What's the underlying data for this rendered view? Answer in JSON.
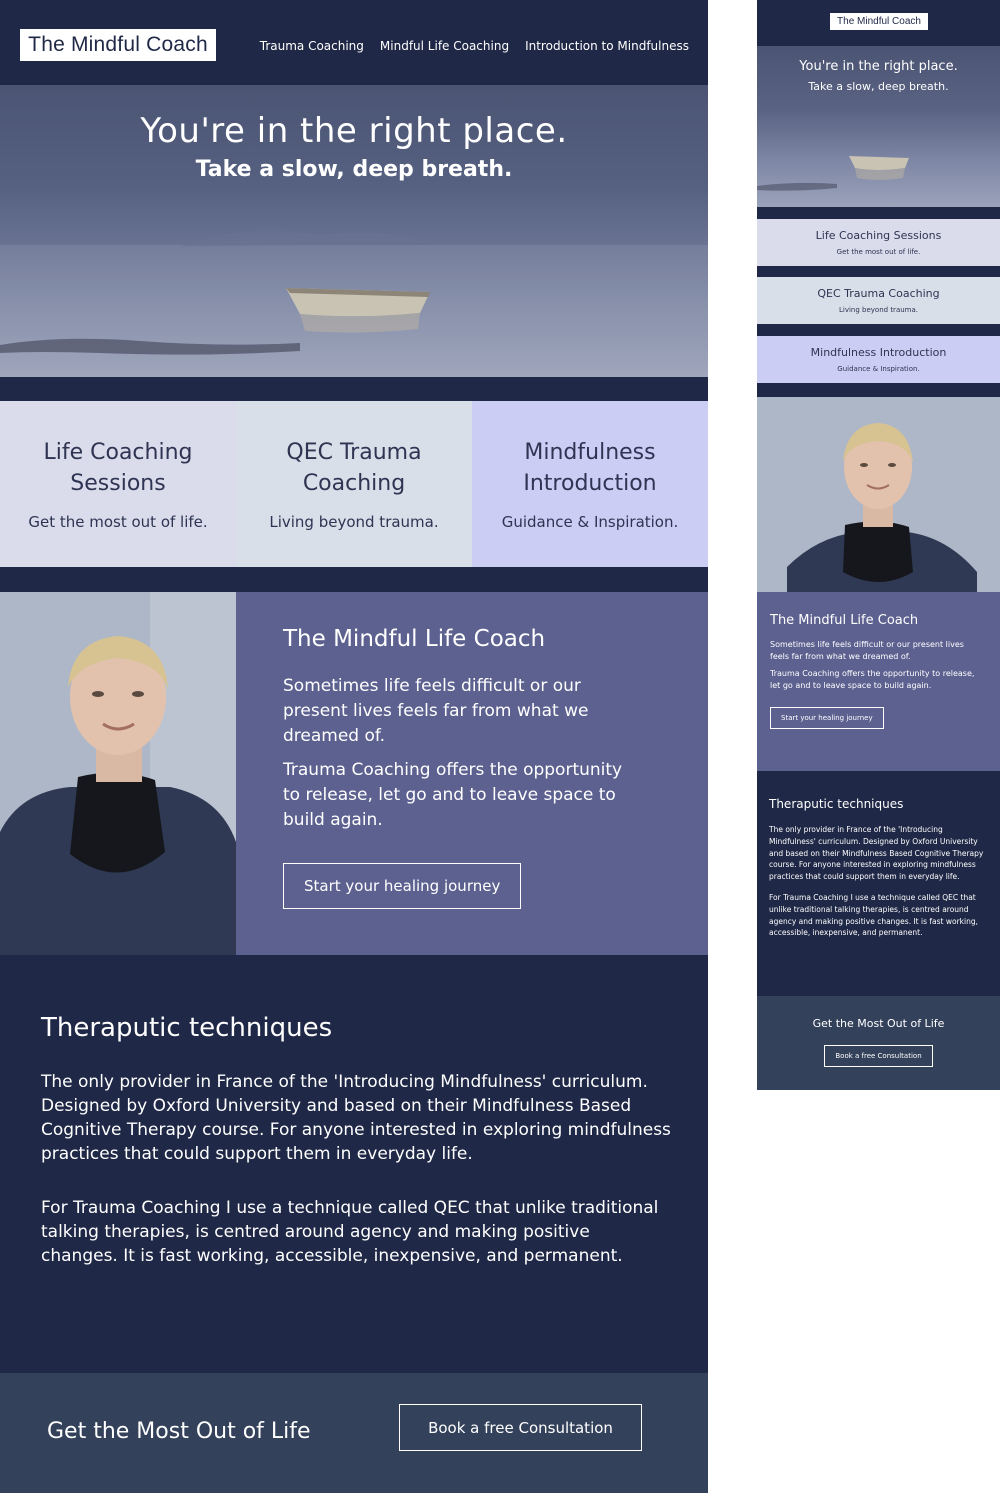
{
  "brand": {
    "logo_text": "The Mindful Coach"
  },
  "nav": {
    "items": [
      {
        "label": "Trauma Coaching"
      },
      {
        "label": "Mindful Life Coaching"
      },
      {
        "label": "Introduction to Mindfulness"
      }
    ]
  },
  "hero": {
    "headline": "You're in the right place.",
    "subheadline": "Take a slow, deep breath."
  },
  "services": [
    {
      "title": "Life Coaching Sessions",
      "tagline": "Get the most out of life.",
      "color": "#dadbeb"
    },
    {
      "title": "QEC Trauma Coaching",
      "tagline": "Living beyond trauma.",
      "color": "#d9dfe9"
    },
    {
      "title": "Mindfulness Introduction",
      "tagline": "Guidance & Inspiration.",
      "color": "#cbcdf4"
    }
  ],
  "coach": {
    "title": "The Mindful Life Coach",
    "para1": "Sometimes life feels difficult or our present lives feels far from what we dreamed of.",
    "para2": "Trauma Coaching offers the opportunity to release, let go and to leave space to build again.",
    "cta_label": "Start your healing journey"
  },
  "techniques": {
    "title": "Theraputic techniques",
    "para1": "The only provider in France of the 'Introducing Mindfulness' curriculum. Designed by Oxford University and based on their Mindfulness Based Cognitive Therapy course. For anyone interested in exploring mindfulness practices that could support them in everyday life.",
    "para2": "For Trauma Coaching I use a technique called QEC that unlike traditional talking therapies, is centred around agency and making positive changes. It is fast working, accessible, inexpensive, and permanent."
  },
  "cta": {
    "title": "Get the Most Out of Life",
    "button_label": "Book a free Consultation"
  },
  "colors": {
    "navy": "#1f2846",
    "purple": "#5d6190",
    "slate": "#33415a",
    "white": "#ffffff"
  }
}
